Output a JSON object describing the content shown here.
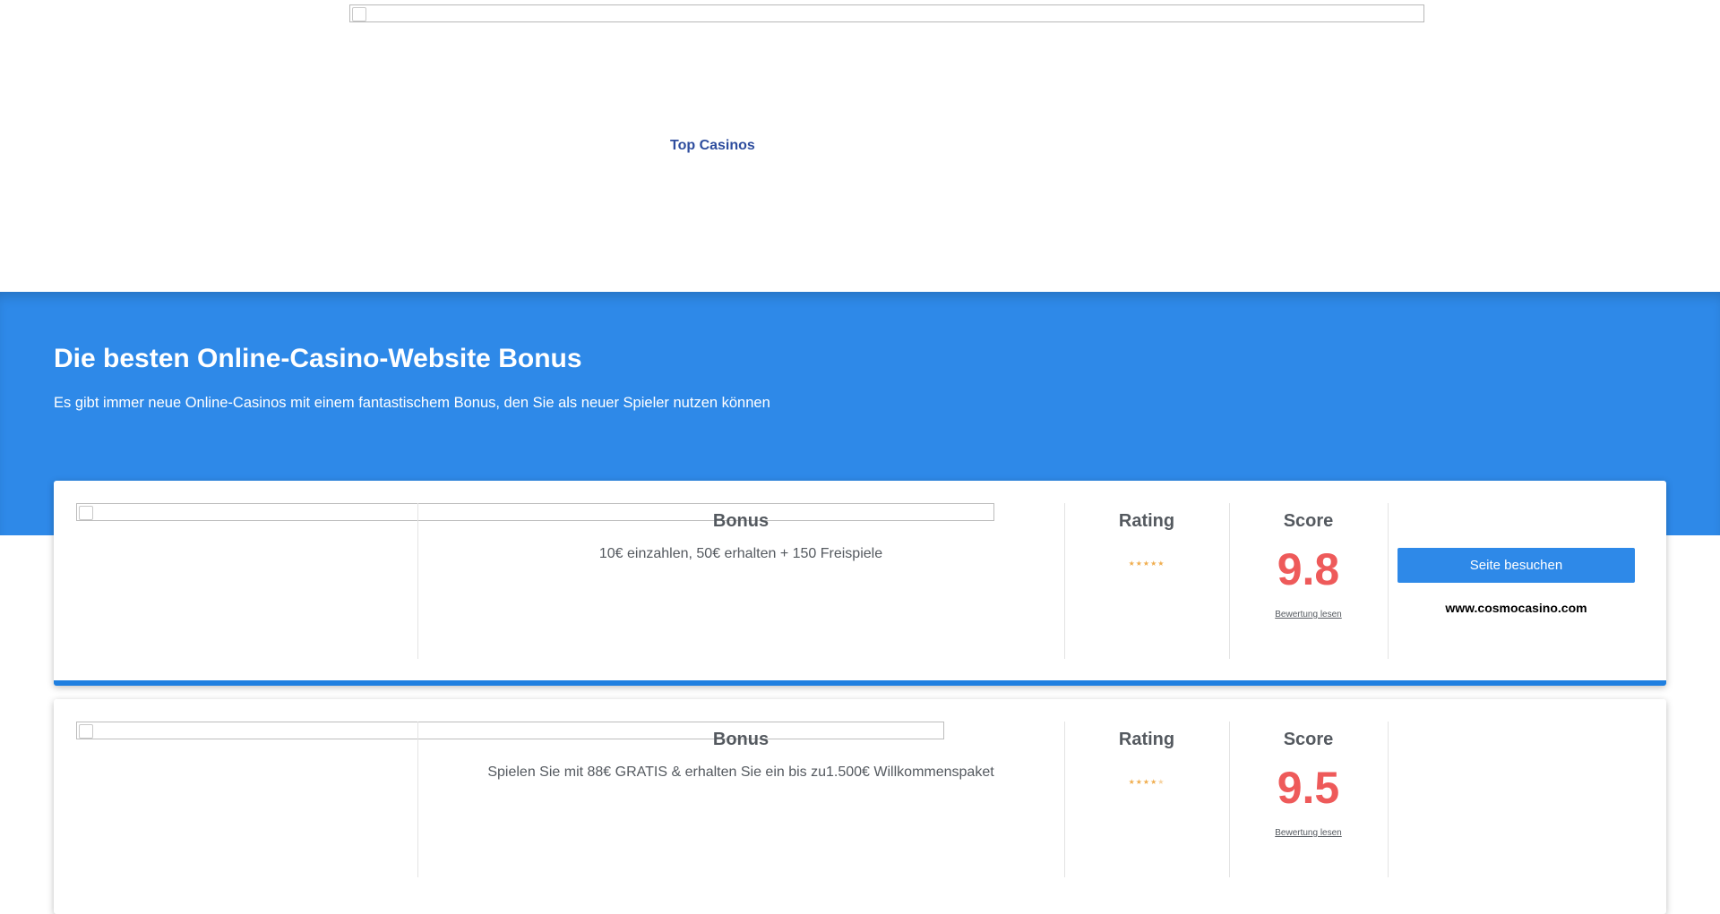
{
  "header": {
    "nav_label": "Top Casinos"
  },
  "hero": {
    "title": "Die besten Online-Casino-Website Bonus",
    "subtitle": "Es gibt immer neue Online-Casinos mit einem fantastischem Bonus, den Sie als neuer Spieler nutzen können"
  },
  "colors": {
    "hero_bg": "#2e89e8",
    "accent": "#1f7fe0",
    "score": "#ee5a5a",
    "nav": "#2e4d9e",
    "stars": "#f0ad4e"
  },
  "casinos": [
    {
      "bonus_label": "Bonus",
      "bonus_text": "10€ einzahlen, 50€ erhalten + 150 Freispiele",
      "rating_label": "Rating",
      "rating_stars": 5,
      "score_label": "Score",
      "score": "9.8",
      "review_link": "Bewertung lesen",
      "visit_button": "Seite besuchen",
      "site_url": "www.cosmocasino.com"
    },
    {
      "bonus_label": "Bonus",
      "bonus_text": "Spielen Sie mit 88€ GRATIS & erhalten Sie ein bis zu1.500€ Willkommenspaket",
      "rating_label": "Rating",
      "rating_stars": 4.5,
      "score_label": "Score",
      "score": "9.5",
      "review_link": "Bewertung lesen"
    }
  ]
}
